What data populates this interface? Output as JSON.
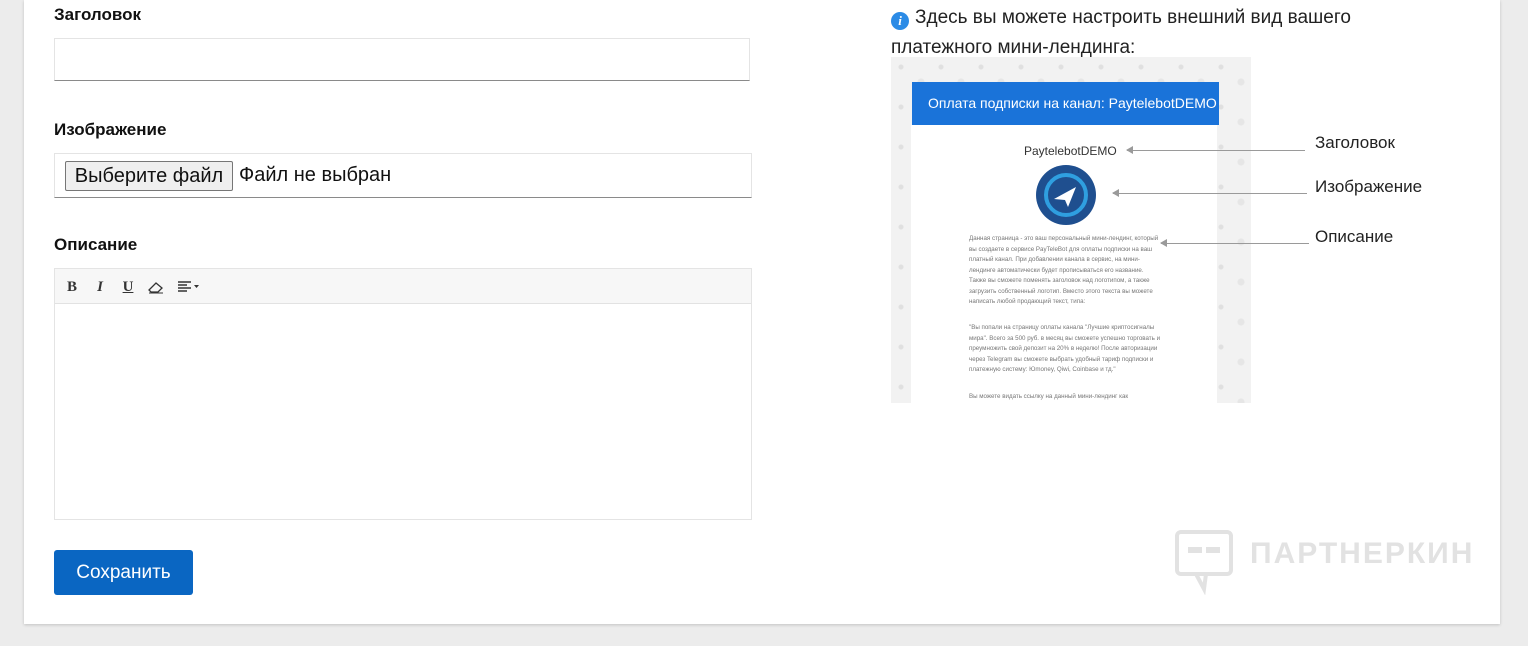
{
  "form": {
    "title_label": "Заголовок",
    "title_value": "",
    "image_label": "Изображение",
    "file_button": "Выберите файл",
    "file_status": "Файл не выбран",
    "description_label": "Описание",
    "toolbar": {
      "bold": "B",
      "italic": "I",
      "underline": "U"
    },
    "save_label": "Сохранить"
  },
  "info": {
    "text": "Здесь вы можете настроить внешний вид вашего платежного мини-лендинга:"
  },
  "preview": {
    "header": "Оплата подписки на канал: PaytelebotDEMO",
    "title": "PaytelebotDEMO",
    "paragraph1": "Данная страница - это ваш персональный мини-лендинг, который вы создаете в сервисе PayTeleBot для оплаты подписки на ваш платный канал. При добавлении канала в сервис, на мини-лендинге автоматически будет прописываться его название. Также вы сможете поменять заголовок над логотипом, а также загрузить собственный логотип. Вместо этого текста вы можете написать любой продающий текст, типа:",
    "paragraph2": "\"Вы попали на страницу оплаты канала \"Лучшие криптосигналы мира\". Всего за 500 руб. в месяц вы сможете успешно торговать и преумножить свой депозит на 20% в неделю! После авторизации через Telegram вы сможете выбрать удобный тариф подписки и платежную систему: Юmoney, Qiwi, Coinbase и тд.\"",
    "paragraph3": "Вы можете видать ссылку на данный мини-лендинг как",
    "callout_title": "Заголовок",
    "callout_image": "Изображение",
    "callout_description": "Описание"
  },
  "watermark": {
    "text": "ПАРТНЕРКИН"
  },
  "colors": {
    "primary": "#0a66c2",
    "info_icon": "#2b8be6",
    "preview_header": "#1a73d9"
  }
}
